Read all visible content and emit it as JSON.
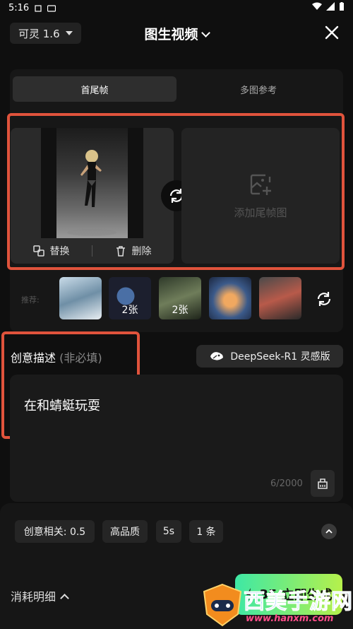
{
  "status_bar": {
    "time": "5:16"
  },
  "header": {
    "version": "可灵 1.6",
    "title": "图生视频"
  },
  "tabs": [
    {
      "label": "首尾帧",
      "active": true
    },
    {
      "label": "多图参考",
      "active": false
    }
  ],
  "first_frame": {
    "replace_label": "替换",
    "delete_label": "删除"
  },
  "end_frame": {
    "placeholder": "添加尾帧图"
  },
  "recommend": {
    "label": "推荐:",
    "items": [
      {
        "badge": ""
      },
      {
        "badge": "2张"
      },
      {
        "badge": "2张"
      },
      {
        "badge": ""
      },
      {
        "badge": ""
      }
    ]
  },
  "description": {
    "title": "创意描述",
    "optional": "(非必填)",
    "deepseek_label": "DeepSeek-R1 灵感版",
    "prompt": "在和蜻蜓玩耍",
    "counter": "6/2000"
  },
  "settings": {
    "creativity": "创意相关: 0.5",
    "quality": "高品质",
    "duration": "5s",
    "count": "1 条"
  },
  "footer": {
    "cost_detail": "消耗明细",
    "credits": "35",
    "generate_label": "立即生成"
  },
  "watermark": {
    "text": "西美手游网",
    "url": "www.hanxm.com"
  },
  "colors": {
    "highlight": "#e0533c",
    "generate_gradient_start": "#3ee8a5",
    "generate_gradient_end": "#b6f04b"
  }
}
